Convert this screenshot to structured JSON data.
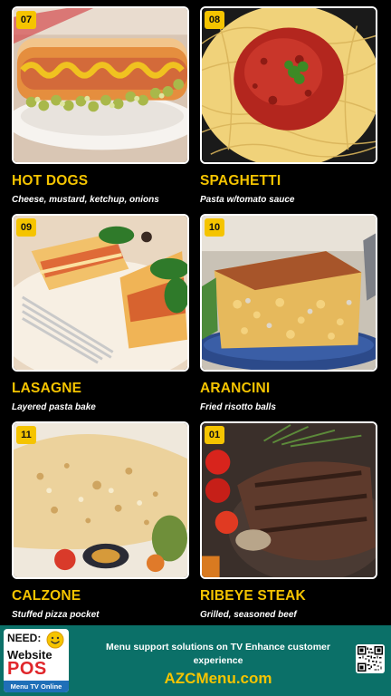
{
  "menu": {
    "items": [
      {
        "number": "07",
        "name": "HOT DOGS",
        "description": "Cheese, mustard, ketchup, onions"
      },
      {
        "number": "08",
        "name": "SPAGHETTI",
        "description": "Pasta w/tomato sauce"
      },
      {
        "number": "09",
        "name": "LASAGNE",
        "description": "Layered pasta bake"
      },
      {
        "number": "10",
        "name": "ARANCINI",
        "description": "Fried risotto balls"
      },
      {
        "number": "11",
        "name": "CALZONE",
        "description": "Stuffed pizza pocket"
      },
      {
        "number": "01",
        "name": "RIBEYE STEAK",
        "description": "Grilled, seasoned beef"
      }
    ]
  },
  "footer": {
    "logo_need": "NEED:",
    "logo_website": "Website",
    "logo_pos": "POS",
    "logo_sub": "Menu TV Online",
    "tagline": "Menu support solutions on TV Enhance customer experience",
    "site": "AZCMenu.com"
  },
  "colors": {
    "accent": "#f5c400",
    "footer_bg": "#0b7068",
    "background": "#000000"
  }
}
